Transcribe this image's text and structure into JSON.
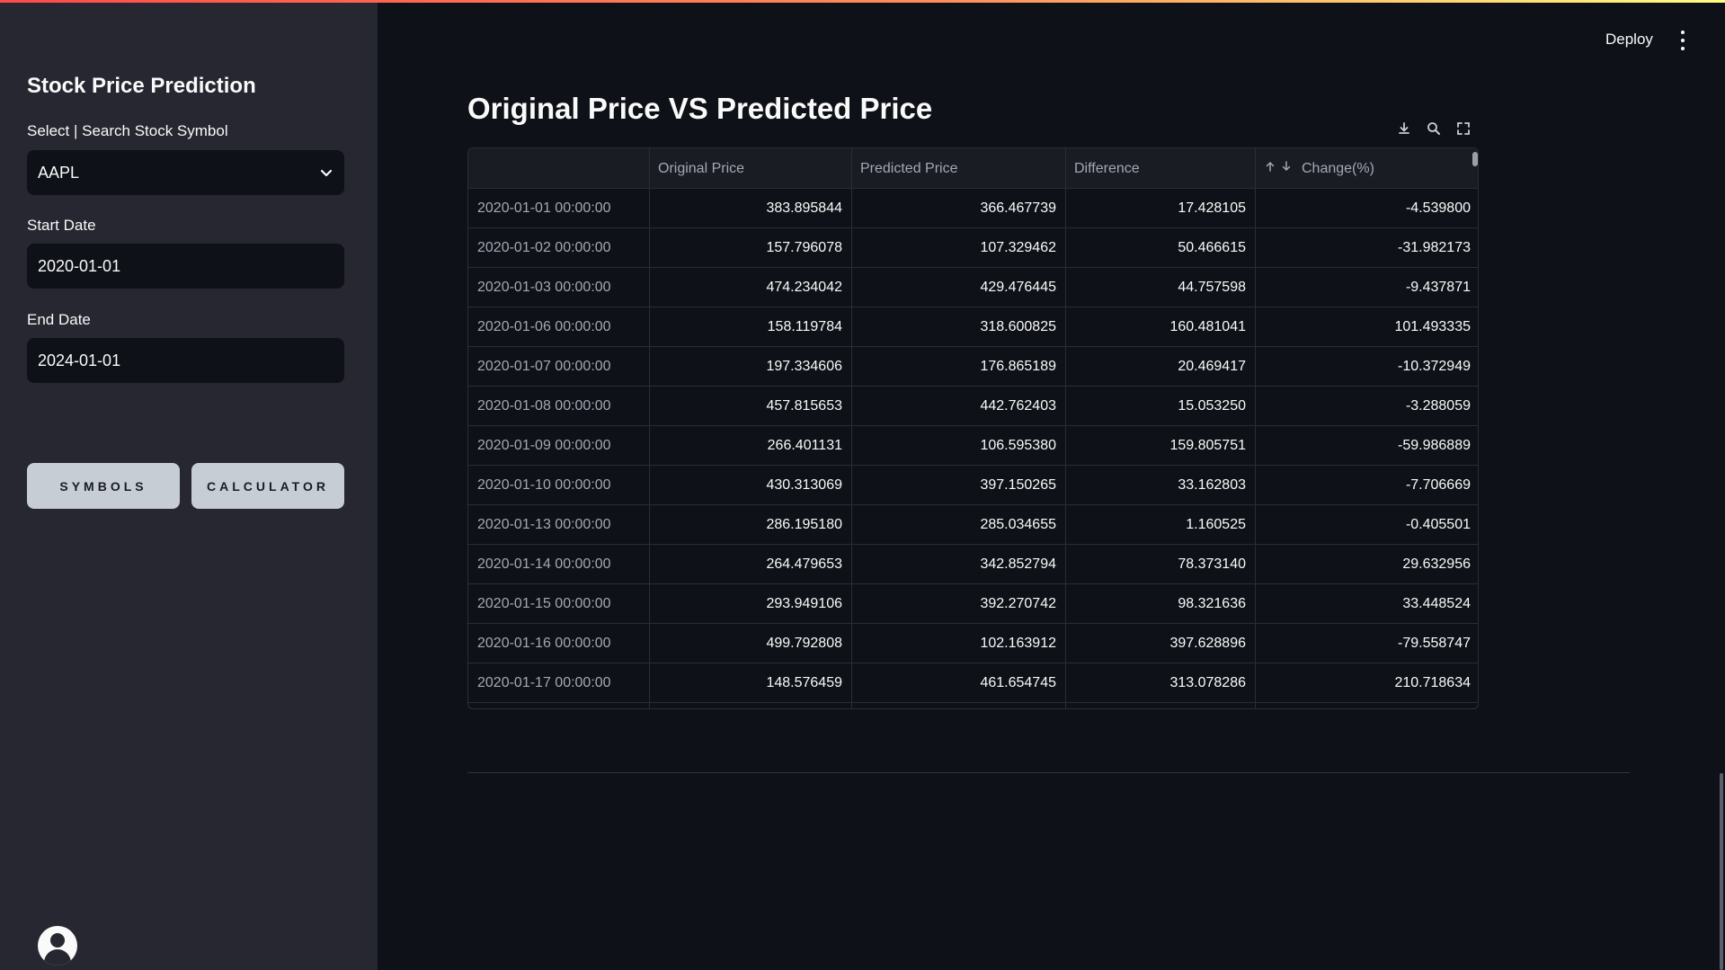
{
  "sidebar": {
    "title": "Stock Price Prediction",
    "symbol_label": "Select | Search Stock Symbol",
    "symbol_value": "AAPL",
    "start_label": "Start Date",
    "start_value": "2020-01-01",
    "end_label": "End Date",
    "end_value": "2024-01-01",
    "symbols_button": "SYMBOLS",
    "calculator_button": "CALCULATOR"
  },
  "header": {
    "deploy_label": "Deploy",
    "menu_icon": "kebab-menu-icon"
  },
  "main": {
    "title": "Original Price VS Predicted Price",
    "toolbar_icons": [
      "download-icon",
      "search-icon",
      "fullscreen-icon"
    ]
  },
  "table": {
    "columns": [
      "",
      "Original Price",
      "Predicted Price",
      "Difference",
      "Change(%)"
    ],
    "sort_icons": [
      "arrow-up-icon",
      "arrow-down-icon"
    ],
    "rows": [
      [
        "2020-01-01 00:00:00",
        "383.895844",
        "366.467739",
        "17.428105",
        "-4.539800"
      ],
      [
        "2020-01-02 00:00:00",
        "157.796078",
        "107.329462",
        "50.466615",
        "-31.982173"
      ],
      [
        "2020-01-03 00:00:00",
        "474.234042",
        "429.476445",
        "44.757598",
        "-9.437871"
      ],
      [
        "2020-01-06 00:00:00",
        "158.119784",
        "318.600825",
        "160.481041",
        "101.493335"
      ],
      [
        "2020-01-07 00:00:00",
        "197.334606",
        "176.865189",
        "20.469417",
        "-10.372949"
      ],
      [
        "2020-01-08 00:00:00",
        "457.815653",
        "442.762403",
        "15.053250",
        "-3.288059"
      ],
      [
        "2020-01-09 00:00:00",
        "266.401131",
        "106.595380",
        "159.805751",
        "-59.986889"
      ],
      [
        "2020-01-10 00:00:00",
        "430.313069",
        "397.150265",
        "33.162803",
        "-7.706669"
      ],
      [
        "2020-01-13 00:00:00",
        "286.195180",
        "285.034655",
        "1.160525",
        "-0.405501"
      ],
      [
        "2020-01-14 00:00:00",
        "264.479653",
        "342.852794",
        "78.373140",
        "29.632956"
      ],
      [
        "2020-01-15 00:00:00",
        "293.949106",
        "392.270742",
        "98.321636",
        "33.448524"
      ],
      [
        "2020-01-16 00:00:00",
        "499.792808",
        "102.163912",
        "397.628896",
        "-79.558747"
      ],
      [
        "2020-01-17 00:00:00",
        "148.576459",
        "461.654745",
        "313.078286",
        "210.718634"
      ]
    ]
  },
  "colors": {
    "background": "#0e1117",
    "sidebar": "#262730",
    "accent_start": "#ff4b4b",
    "accent_end": "#fffd80",
    "button": "#c7cdd4"
  }
}
